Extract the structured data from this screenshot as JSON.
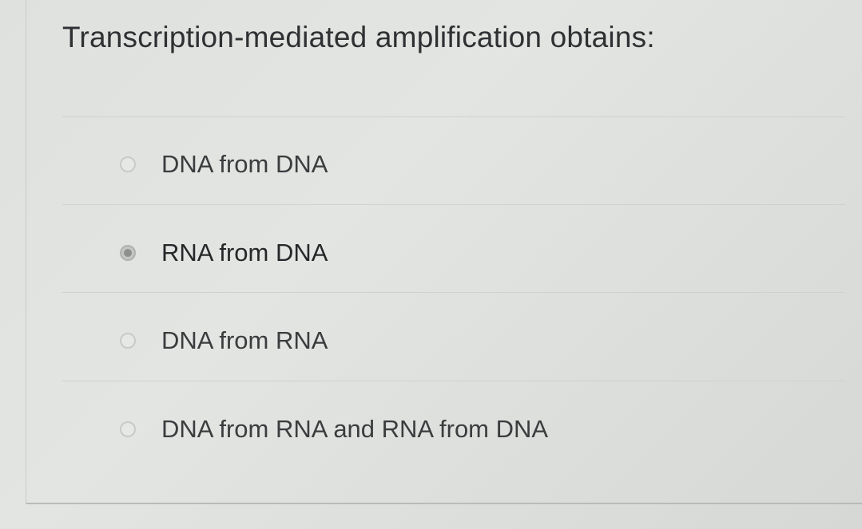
{
  "question": {
    "text": "Transcription-mediated amplification obtains:"
  },
  "options": [
    {
      "label": "DNA from DNA",
      "selected": false
    },
    {
      "label": "RNA from DNA",
      "selected": true
    },
    {
      "label": "DNA from RNA",
      "selected": false
    },
    {
      "label": "DNA from RNA and RNA from DNA",
      "selected": false
    }
  ]
}
